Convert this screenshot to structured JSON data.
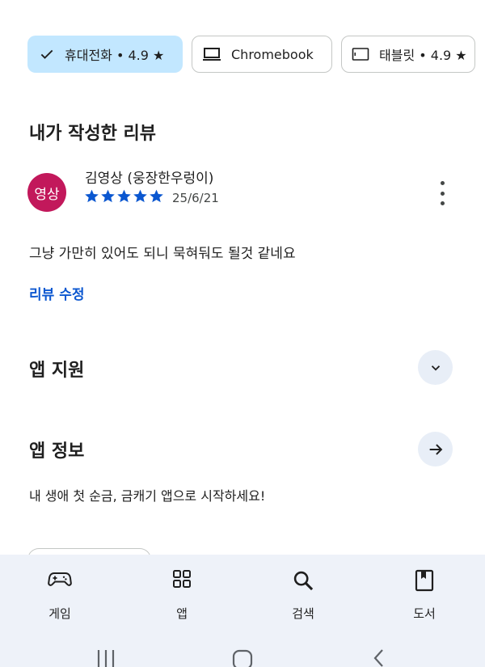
{
  "filters": [
    {
      "label": "휴대전화 • 4.9 ★",
      "icon": "check-icon",
      "selected": true
    },
    {
      "label": "Chromebook",
      "icon": "laptop-icon",
      "selected": false
    },
    {
      "label": "태블릿 • 4.9 ★",
      "icon": "tablet-icon",
      "selected": false
    }
  ],
  "my_review": {
    "section_title": "내가 작성한 리뷰",
    "avatar_text": "영상",
    "reviewer_name": "김영상 (웅장한우렁이)",
    "rating": 5,
    "date": "25/6/21",
    "text": "그냥 가만히 있어도 되니 묵혀둬도 될것 같네요",
    "edit_label": "리뷰 수정"
  },
  "app_support": {
    "title": "앱 지원",
    "icon": "chevron-down-icon"
  },
  "app_info": {
    "title": "앱 정보",
    "icon": "arrow-right-icon",
    "description": "내 생애 첫 순금, 금캐기 앱으로 시작하세요!"
  },
  "bottom_nav": [
    {
      "label": "게임",
      "icon": "gamepad-icon"
    },
    {
      "label": "앱",
      "icon": "apps-grid-icon"
    },
    {
      "label": "검색",
      "icon": "search-icon"
    },
    {
      "label": "도서",
      "icon": "book-icon"
    }
  ],
  "colors": {
    "accent": "#0b57d0",
    "chip_selected": "#c2e7ff",
    "avatar": "#c2185b",
    "nav_bg": "#eef2f9"
  }
}
